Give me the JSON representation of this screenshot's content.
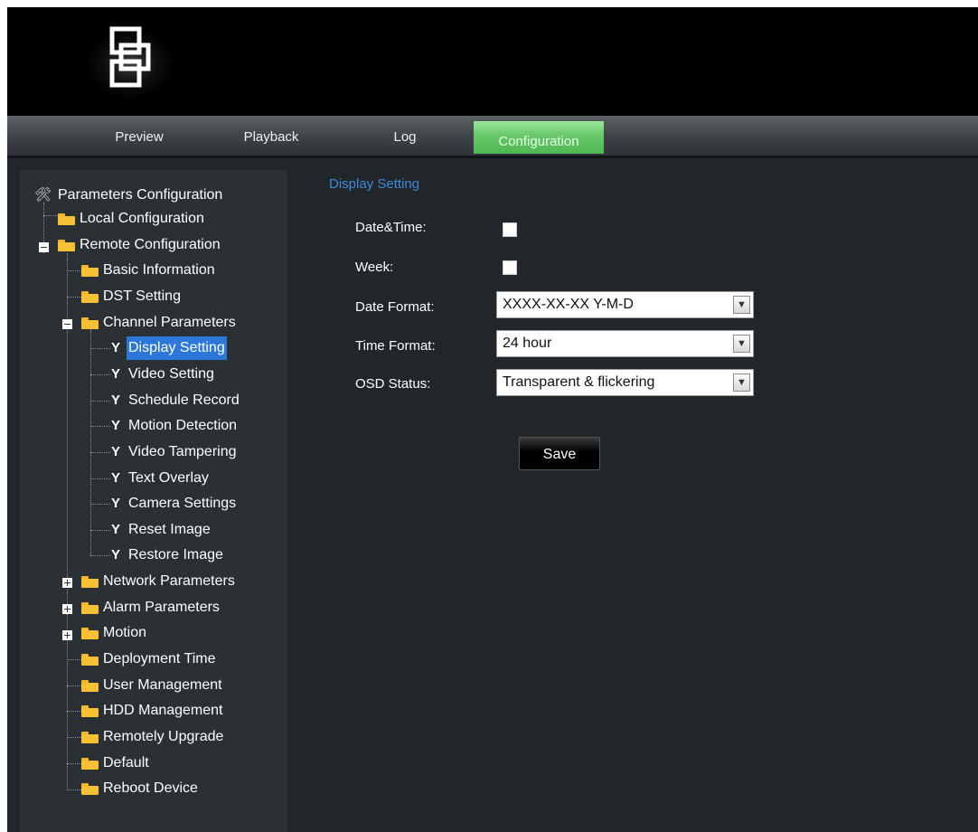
{
  "nav": {
    "tabs": [
      {
        "label": "Preview",
        "active": false
      },
      {
        "label": "Playback",
        "active": false
      },
      {
        "label": "Log",
        "active": false
      },
      {
        "label": "Configuration",
        "active": true
      }
    ]
  },
  "sidebar": {
    "root": "Parameters Configuration",
    "local": "Local Configuration",
    "remote": "Remote Configuration",
    "basic_information": "Basic Information",
    "dst_setting": "DST Setting",
    "channel_parameters": "Channel Parameters",
    "channel_items": [
      {
        "label": "Display Setting",
        "selected": true
      },
      {
        "label": "Video Setting",
        "selected": false
      },
      {
        "label": "Schedule Record",
        "selected": false
      },
      {
        "label": "Motion Detection",
        "selected": false
      },
      {
        "label": "Video Tampering",
        "selected": false
      },
      {
        "label": "Text Overlay",
        "selected": false
      },
      {
        "label": "Camera Settings",
        "selected": false
      },
      {
        "label": "Reset Image",
        "selected": false
      },
      {
        "label": "Restore Image",
        "selected": false
      }
    ],
    "collapsed_groups": [
      "Network Parameters",
      "Alarm Parameters",
      "Motion"
    ],
    "leaf_items": [
      "Deployment Time",
      "User Management",
      "HDD Management",
      "Remotely Upgrade",
      "Default",
      "Reboot Device"
    ]
  },
  "content": {
    "title": "Display Setting",
    "fields": {
      "date_time_label": "Date&Time:",
      "week_label": "Week:",
      "date_format_label": "Date Format:",
      "date_format_value": "XXXX-XX-XX Y-M-D",
      "time_format_label": "Time Format:",
      "time_format_value": "24 hour",
      "osd_status_label": "OSD Status:",
      "osd_status_value": "Transparent & flickering"
    },
    "save_label": "Save"
  },
  "colors": {
    "accent_green": "#5cc35e",
    "selected_blue": "#2c78d8",
    "title_blue": "#3f8ad8",
    "folder_yellow": "#f7c035"
  }
}
